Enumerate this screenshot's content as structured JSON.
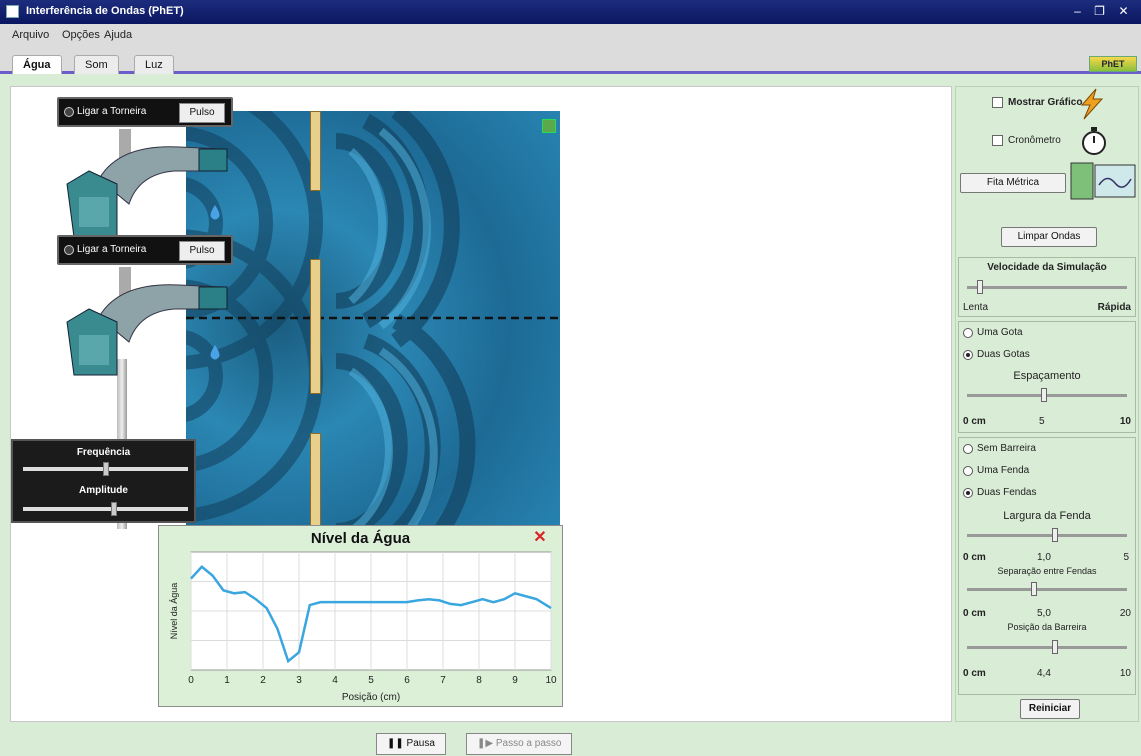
{
  "window": {
    "title": "Interferência de Ondas (PhET)",
    "controls": [
      "–",
      "❐",
      "✕"
    ]
  },
  "menu": {
    "items": [
      "Arquivo",
      "Opções",
      "Ajuda"
    ]
  },
  "tabs": [
    {
      "label": "Água"
    },
    {
      "label": "Som"
    },
    {
      "label": "Luz"
    }
  ],
  "logo": "PhET",
  "faucets": [
    {
      "mode_label": "Ligar a Torneira",
      "button": "Pulso"
    },
    {
      "mode_label": "Ligar a Torneira",
      "button": "Pulso"
    }
  ],
  "amplitude_panel": {
    "frequency_label": "Frequência",
    "amplitude_label": "Amplitude",
    "frequency_value": 0.5,
    "amplitude_value": 0.55
  },
  "graph": {
    "title": "Nível da Água",
    "ylabel": "Nível da Água",
    "xlabel": "Posição (cm)",
    "x_ticks": [
      "0",
      "1",
      "2",
      "3",
      "4",
      "5",
      "6",
      "7",
      "8",
      "9",
      "10"
    ]
  },
  "chart_data": {
    "type": "line",
    "title": "Nível da Água",
    "xlabel": "Posição (cm)",
    "ylabel": "Nível da Água",
    "xlim": [
      0,
      10
    ],
    "ylim": [
      -1,
      1
    ],
    "grid": true,
    "x": [
      0,
      0.3,
      0.6,
      0.9,
      1.2,
      1.5,
      1.8,
      2.1,
      2.4,
      2.7,
      3.0,
      3.3,
      3.6,
      3.9,
      4.2,
      4.5,
      4.8,
      5.1,
      5.4,
      5.7,
      6.0,
      6.3,
      6.6,
      6.9,
      7.2,
      7.5,
      7.8,
      8.1,
      8.4,
      8.7,
      9.0,
      9.3,
      9.6,
      10.0
    ],
    "y": [
      0.55,
      0.75,
      0.6,
      0.35,
      0.3,
      0.32,
      0.2,
      0.05,
      -0.3,
      -0.85,
      -0.7,
      0.1,
      0.15,
      0.15,
      0.15,
      0.15,
      0.15,
      0.15,
      0.15,
      0.15,
      0.15,
      0.18,
      0.2,
      0.18,
      0.12,
      0.1,
      0.15,
      0.2,
      0.15,
      0.2,
      0.3,
      0.25,
      0.2,
      0.05
    ]
  },
  "right_panel": {
    "show_graph": "Mostrar Gráfico",
    "stopwatch": "Cronômetro",
    "measuring_tape": "Fita Métrica",
    "clear_waves": "Limpar Ondas",
    "sim_speed": {
      "title": "Velocidade da Simulação",
      "min": "Lenta",
      "max": "Rápida",
      "value": 0.08
    },
    "sources": {
      "one": "Uma Gota",
      "two": "Duas Gotas",
      "spacing_title": "Espaçamento",
      "min": "0 cm",
      "mid": "5",
      "max": "10",
      "value": 0.48
    },
    "barrier": {
      "none": "Sem Barreira",
      "one_slit": "Uma Fenda",
      "two_slits": "Duas Fendas",
      "slit_width_title": "Largura da Fenda",
      "slit_width_min": "0 cm",
      "slit_width_mid": "1,0",
      "slit_width_max": "5",
      "slit_width_value": 0.55,
      "slit_sep_title": "Separação entre Fendas",
      "slit_sep_min": "0 cm",
      "slit_sep_mid": "5,0",
      "slit_sep_max": "20",
      "slit_sep_value": 0.42,
      "barrier_pos_title": "Posição da Barreira",
      "barrier_pos_min": "0 cm",
      "barrier_pos_mid": "4,4",
      "barrier_pos_max": "10",
      "barrier_pos_value": 0.55,
      "reset": "Reiniciar"
    }
  },
  "bottom": {
    "pause": "Pausa",
    "step": "Passo a passo"
  }
}
